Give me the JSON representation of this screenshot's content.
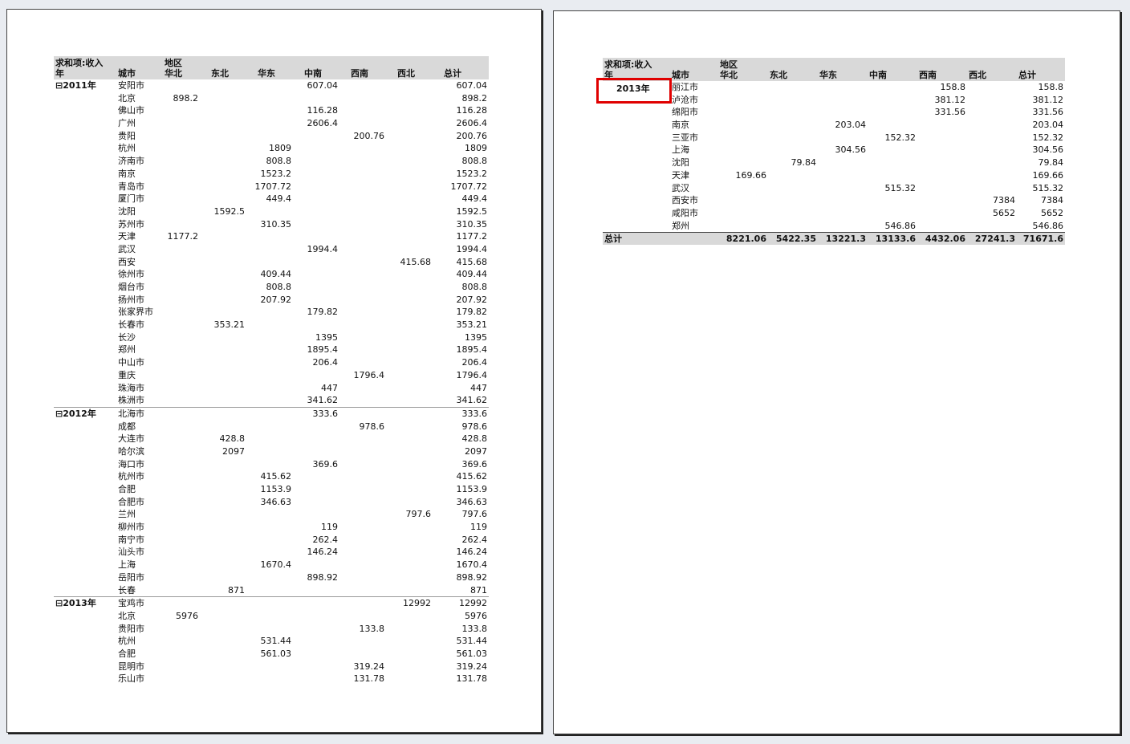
{
  "page1": {
    "header": {
      "value_field": "求和项:收入",
      "column_field": "地区",
      "row_field": "年",
      "city_label": "城市",
      "regions": [
        "华北",
        "东北",
        "华东",
        "中南",
        "西南",
        "西北"
      ],
      "total_label": "总计"
    },
    "rows": [
      {
        "year": "⊟2011年",
        "city": "安阳市",
        "vals": [
          "",
          "",
          "",
          "607.04",
          "",
          ""
        ],
        "total": "607.04"
      },
      {
        "year": "",
        "city": "北京",
        "vals": [
          "898.2",
          "",
          "",
          "",
          "",
          ""
        ],
        "total": "898.2"
      },
      {
        "year": "",
        "city": "佛山市",
        "vals": [
          "",
          "",
          "",
          "116.28",
          "",
          ""
        ],
        "total": "116.28"
      },
      {
        "year": "",
        "city": "广州",
        "vals": [
          "",
          "",
          "",
          "2606.4",
          "",
          ""
        ],
        "total": "2606.4"
      },
      {
        "year": "",
        "city": "贵阳",
        "vals": [
          "",
          "",
          "",
          "",
          "200.76",
          ""
        ],
        "total": "200.76"
      },
      {
        "year": "",
        "city": "杭州",
        "vals": [
          "",
          "",
          "1809",
          "",
          "",
          ""
        ],
        "total": "1809"
      },
      {
        "year": "",
        "city": "济南市",
        "vals": [
          "",
          "",
          "808.8",
          "",
          "",
          ""
        ],
        "total": "808.8"
      },
      {
        "year": "",
        "city": "南京",
        "vals": [
          "",
          "",
          "1523.2",
          "",
          "",
          ""
        ],
        "total": "1523.2"
      },
      {
        "year": "",
        "city": "青岛市",
        "vals": [
          "",
          "",
          "1707.72",
          "",
          "",
          ""
        ],
        "total": "1707.72"
      },
      {
        "year": "",
        "city": "厦门市",
        "vals": [
          "",
          "",
          "449.4",
          "",
          "",
          ""
        ],
        "total": "449.4"
      },
      {
        "year": "",
        "city": "沈阳",
        "vals": [
          "",
          "1592.5",
          "",
          "",
          "",
          ""
        ],
        "total": "1592.5"
      },
      {
        "year": "",
        "city": "苏州市",
        "vals": [
          "",
          "",
          "310.35",
          "",
          "",
          ""
        ],
        "total": "310.35"
      },
      {
        "year": "",
        "city": "天津",
        "vals": [
          "1177.2",
          "",
          "",
          "",
          "",
          ""
        ],
        "total": "1177.2"
      },
      {
        "year": "",
        "city": "武汉",
        "vals": [
          "",
          "",
          "",
          "1994.4",
          "",
          ""
        ],
        "total": "1994.4"
      },
      {
        "year": "",
        "city": "西安",
        "vals": [
          "",
          "",
          "",
          "",
          "",
          "415.68"
        ],
        "total": "415.68"
      },
      {
        "year": "",
        "city": "徐州市",
        "vals": [
          "",
          "",
          "409.44",
          "",
          "",
          ""
        ],
        "total": "409.44"
      },
      {
        "year": "",
        "city": "烟台市",
        "vals": [
          "",
          "",
          "808.8",
          "",
          "",
          ""
        ],
        "total": "808.8"
      },
      {
        "year": "",
        "city": "扬州市",
        "vals": [
          "",
          "",
          "207.92",
          "",
          "",
          ""
        ],
        "total": "207.92"
      },
      {
        "year": "",
        "city": "张家界市",
        "vals": [
          "",
          "",
          "",
          "179.82",
          "",
          ""
        ],
        "total": "179.82"
      },
      {
        "year": "",
        "city": "长春市",
        "vals": [
          "",
          "353.21",
          "",
          "",
          "",
          ""
        ],
        "total": "353.21"
      },
      {
        "year": "",
        "city": "长沙",
        "vals": [
          "",
          "",
          "",
          "1395",
          "",
          ""
        ],
        "total": "1395"
      },
      {
        "year": "",
        "city": "郑州",
        "vals": [
          "",
          "",
          "",
          "1895.4",
          "",
          ""
        ],
        "total": "1895.4"
      },
      {
        "year": "",
        "city": "中山市",
        "vals": [
          "",
          "",
          "",
          "206.4",
          "",
          ""
        ],
        "total": "206.4"
      },
      {
        "year": "",
        "city": "重庆",
        "vals": [
          "",
          "",
          "",
          "",
          "1796.4",
          ""
        ],
        "total": "1796.4"
      },
      {
        "year": "",
        "city": "珠海市",
        "vals": [
          "",
          "",
          "",
          "447",
          "",
          ""
        ],
        "total": "447"
      },
      {
        "year": "",
        "city": "株洲市",
        "vals": [
          "",
          "",
          "",
          "341.62",
          "",
          ""
        ],
        "total": "341.62"
      },
      {
        "year": "⊟2012年",
        "city": "北海市",
        "vals": [
          "",
          "",
          "",
          "333.6",
          "",
          ""
        ],
        "total": "333.6"
      },
      {
        "year": "",
        "city": "成都",
        "vals": [
          "",
          "",
          "",
          "",
          "978.6",
          ""
        ],
        "total": "978.6"
      },
      {
        "year": "",
        "city": "大连市",
        "vals": [
          "",
          "428.8",
          "",
          "",
          "",
          ""
        ],
        "total": "428.8"
      },
      {
        "year": "",
        "city": "哈尔滨",
        "vals": [
          "",
          "2097",
          "",
          "",
          "",
          ""
        ],
        "total": "2097"
      },
      {
        "year": "",
        "city": "海口市",
        "vals": [
          "",
          "",
          "",
          "369.6",
          "",
          ""
        ],
        "total": "369.6"
      },
      {
        "year": "",
        "city": "杭州市",
        "vals": [
          "",
          "",
          "415.62",
          "",
          "",
          ""
        ],
        "total": "415.62"
      },
      {
        "year": "",
        "city": "合肥",
        "vals": [
          "",
          "",
          "1153.9",
          "",
          "",
          ""
        ],
        "total": "1153.9"
      },
      {
        "year": "",
        "city": "合肥市",
        "vals": [
          "",
          "",
          "346.63",
          "",
          "",
          ""
        ],
        "total": "346.63"
      },
      {
        "year": "",
        "city": "兰州",
        "vals": [
          "",
          "",
          "",
          "",
          "",
          "797.6"
        ],
        "total": "797.6"
      },
      {
        "year": "",
        "city": "柳州市",
        "vals": [
          "",
          "",
          "",
          "119",
          "",
          ""
        ],
        "total": "119"
      },
      {
        "year": "",
        "city": "南宁市",
        "vals": [
          "",
          "",
          "",
          "262.4",
          "",
          ""
        ],
        "total": "262.4"
      },
      {
        "year": "",
        "city": "汕头市",
        "vals": [
          "",
          "",
          "",
          "146.24",
          "",
          ""
        ],
        "total": "146.24"
      },
      {
        "year": "",
        "city": "上海",
        "vals": [
          "",
          "",
          "1670.4",
          "",
          "",
          ""
        ],
        "total": "1670.4"
      },
      {
        "year": "",
        "city": "岳阳市",
        "vals": [
          "",
          "",
          "",
          "898.92",
          "",
          ""
        ],
        "total": "898.92"
      },
      {
        "year": "",
        "city": "长春",
        "vals": [
          "",
          "871",
          "",
          "",
          "",
          ""
        ],
        "total": "871"
      },
      {
        "year": "⊟2013年",
        "city": "宝鸡市",
        "vals": [
          "",
          "",
          "",
          "",
          "",
          "12992"
        ],
        "total": "12992"
      },
      {
        "year": "",
        "city": "北京",
        "vals": [
          "5976",
          "",
          "",
          "",
          "",
          ""
        ],
        "total": "5976"
      },
      {
        "year": "",
        "city": "贵阳市",
        "vals": [
          "",
          "",
          "",
          "",
          "133.8",
          ""
        ],
        "total": "133.8"
      },
      {
        "year": "",
        "city": "杭州",
        "vals": [
          "",
          "",
          "531.44",
          "",
          "",
          ""
        ],
        "total": "531.44"
      },
      {
        "year": "",
        "city": "合肥",
        "vals": [
          "",
          "",
          "561.03",
          "",
          "",
          ""
        ],
        "total": "561.03"
      },
      {
        "year": "",
        "city": "昆明市",
        "vals": [
          "",
          "",
          "",
          "",
          "319.24",
          ""
        ],
        "total": "319.24"
      },
      {
        "year": "",
        "city": "乐山市",
        "vals": [
          "",
          "",
          "",
          "",
          "131.78",
          ""
        ],
        "total": "131.78"
      }
    ]
  },
  "page2": {
    "header": {
      "value_field": "求和项:收入",
      "column_field": "地区",
      "row_field": "年",
      "city_label": "城市",
      "regions": [
        "华北",
        "东北",
        "华东",
        "中南",
        "西南",
        "西北"
      ],
      "total_label": "总计"
    },
    "highlighted_year": "2013年",
    "rows": [
      {
        "city": "丽江市",
        "vals": [
          "",
          "",
          "",
          "",
          "158.8",
          ""
        ],
        "total": "158.8"
      },
      {
        "city": "泸沧市",
        "vals": [
          "",
          "",
          "",
          "",
          "381.12",
          ""
        ],
        "total": "381.12"
      },
      {
        "city": "绵阳市",
        "vals": [
          "",
          "",
          "",
          "",
          "331.56",
          ""
        ],
        "total": "331.56"
      },
      {
        "city": "南京",
        "vals": [
          "",
          "",
          "203.04",
          "",
          "",
          ""
        ],
        "total": "203.04"
      },
      {
        "city": "三亚市",
        "vals": [
          "",
          "",
          "",
          "152.32",
          "",
          ""
        ],
        "total": "152.32"
      },
      {
        "city": "上海",
        "vals": [
          "",
          "",
          "304.56",
          "",
          "",
          ""
        ],
        "total": "304.56"
      },
      {
        "city": "沈阳",
        "vals": [
          "",
          "79.84",
          "",
          "",
          "",
          ""
        ],
        "total": "79.84"
      },
      {
        "city": "天津",
        "vals": [
          "169.66",
          "",
          "",
          "",
          "",
          ""
        ],
        "total": "169.66"
      },
      {
        "city": "武汉",
        "vals": [
          "",
          "",
          "",
          "515.32",
          "",
          ""
        ],
        "total": "515.32"
      },
      {
        "city": "西安市",
        "vals": [
          "",
          "",
          "",
          "",
          "",
          "7384"
        ],
        "total": "7384"
      },
      {
        "city": "咸阳市",
        "vals": [
          "",
          "",
          "",
          "",
          "",
          "5652"
        ],
        "total": "5652"
      },
      {
        "city": "郑州",
        "vals": [
          "",
          "",
          "",
          "546.86",
          "",
          ""
        ],
        "total": "546.86"
      }
    ],
    "grand_total": {
      "label": "总计",
      "vals": [
        "8221.06",
        "5422.35",
        "13221.3",
        "13133.6",
        "4432.06",
        "27241.3"
      ],
      "total": "71671.6"
    }
  },
  "colors": {
    "highlight": "#e00000",
    "header_bg": "#d9d9d9"
  }
}
